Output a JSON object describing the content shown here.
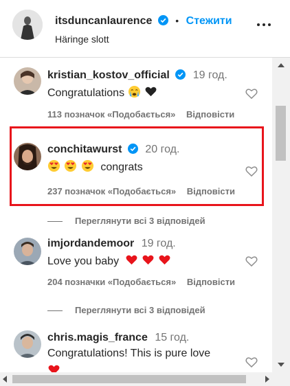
{
  "header": {
    "username": "itsduncanlaurence",
    "separator": "•",
    "follow_label": "Стежити",
    "location": "Häringe slott",
    "more_icon": "more-horizontal-icon"
  },
  "colors": {
    "accent": "#0095f6",
    "verified": "#0095f6",
    "highlight": "#e8141b",
    "muted": "#737373"
  },
  "comments": [
    {
      "username": "kristian_kostov_official",
      "time": "19 год.",
      "text": "Congratulations",
      "emojis": [
        "crying-face-emoji",
        "black-heart-emoji"
      ],
      "likes": "113 позначок «Подобається»",
      "reply": "Відповісти"
    },
    {
      "username": "conchitawurst",
      "time": "20 год.",
      "text": "congrats",
      "emojis": [
        "heart-eyes-emoji",
        "heart-eyes-emoji",
        "heart-eyes-emoji"
      ],
      "likes": "237 позначок «Подобається»",
      "reply": "Відповісти",
      "view_replies": "Переглянути всі 3 відповідей"
    },
    {
      "username": "imjordandemoor",
      "time": "19 год.",
      "text": "Love you baby",
      "emojis": [
        "red-heart-emoji",
        "red-heart-emoji",
        "red-heart-emoji"
      ],
      "likes": "204 позначки «Подобається»",
      "reply": "Відповісти",
      "view_replies": "Переглянути всі 3 відповідей"
    },
    {
      "username": "chris.magis_france",
      "time": "15 год.",
      "text": "Congratulations! This is pure love",
      "emojis": [
        "red-heart-emoji"
      ]
    }
  ]
}
